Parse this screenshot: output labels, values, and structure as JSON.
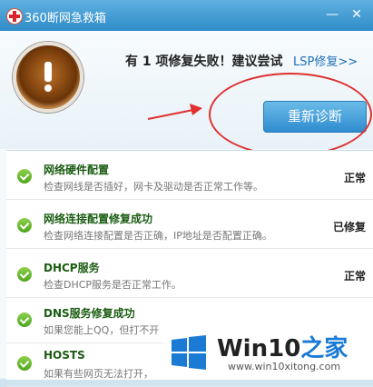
{
  "window": {
    "title": "360断网急救箱",
    "controls": [
      "—",
      "✕"
    ]
  },
  "header": {
    "result_text": "有 1 项修复失败！建议尝试",
    "lsp_link": "LSP修复>>",
    "rediagnose_label": "重新诊断"
  },
  "items": [
    {
      "title": "网络硬件配置",
      "desc": "检查网线是否插好，网卡及驱动是否正常工作等。",
      "status": "正常"
    },
    {
      "title": "网络连接配置修复成功",
      "desc": "检查网络连接配置是否正确，IP地址是否配置正确。",
      "status": "已修复"
    },
    {
      "title": "DHCP服务",
      "desc": "检查DHCP服务是否正常工作。",
      "status": "正常"
    },
    {
      "title": "DNS服务修复成功",
      "desc": "如果您能上QQ，但打不开",
      "status": ""
    },
    {
      "title": "HOSTS",
      "desc": "如果有些网页无法打开，",
      "status": ""
    }
  ],
  "watermark": {
    "brand_a": "Win10",
    "brand_b": "之家",
    "url": "www.win10xitong.com"
  },
  "colors": {
    "titlebar": "#2f8cc9",
    "accent": "#1f6fb6",
    "check": "#4ea51b",
    "annotation": "#e03030"
  }
}
